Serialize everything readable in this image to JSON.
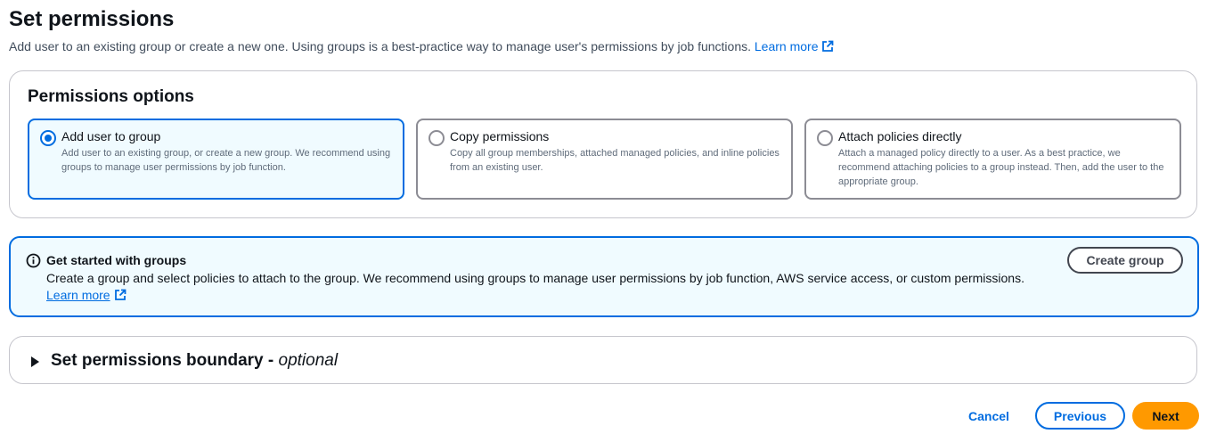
{
  "header": {
    "title": "Set permissions",
    "description": "Add user to an existing group or create a new one. Using groups is a best-practice way to manage user's permissions by job functions.",
    "learn_more": "Learn more"
  },
  "permissions_options": {
    "title": "Permissions options",
    "selected": "Add user to group",
    "options": [
      {
        "label": "Add user to group",
        "description": "Add user to an existing group, or create a new group. We recommend using groups to manage user permissions by job function."
      },
      {
        "label": "Copy permissions",
        "description": "Copy all group memberships, attached managed policies, and inline policies from an existing user."
      },
      {
        "label": "Attach policies directly",
        "description": "Attach a managed policy directly to a user. As a best practice, we recommend attaching policies to a group instead. Then, add the user to the appropriate group."
      }
    ]
  },
  "info_alert": {
    "title": "Get started with groups",
    "text": "Create a group and select policies to attach to the group. We recommend using groups to manage user permissions by job function, AWS service access, or custom permissions.",
    "learn_more": "Learn more",
    "button": "Create group"
  },
  "boundary": {
    "title": "Set permissions boundary - ",
    "optional": "optional"
  },
  "footer": {
    "cancel": "Cancel",
    "previous": "Previous",
    "next": "Next"
  },
  "colors": {
    "accent": "#006ce0",
    "primary_button": "#ff9900",
    "selected_tile_bg": "#f0fbff"
  }
}
